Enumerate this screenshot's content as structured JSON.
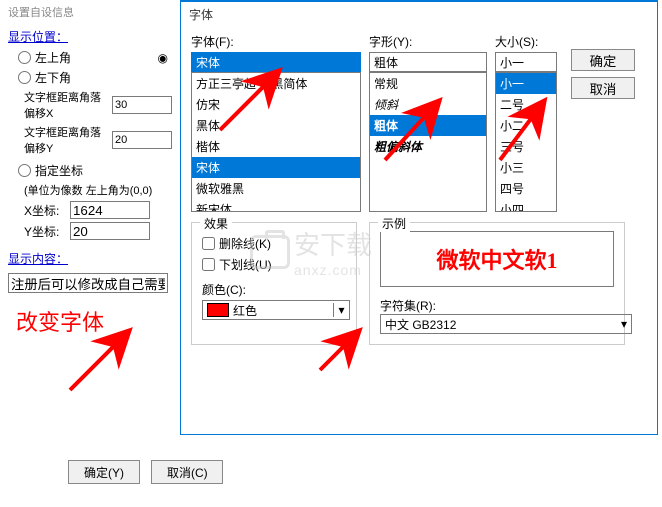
{
  "window_title": "设置自设信息",
  "left": {
    "pos_label": "显示位置：",
    "opt_topleft": "左上角",
    "opt_bottomleft": "左下角",
    "offset_x_label": "文字框距离角落偏移X",
    "offset_x": "30",
    "offset_y_label": "文字框距离角落偏移Y",
    "offset_y": "20",
    "opt_coord": "指定坐标",
    "coord_hint": "(单位为像数 左上角为(0,0)",
    "x_label": "X坐标:",
    "x_val": "1624",
    "y_label": "Y坐标:",
    "y_val": "20",
    "content_label": "显示内容：",
    "content_val": "注册后可以修改成自己需要的！",
    "big_red": "改变字体",
    "ok": "确定(Y)",
    "cancel": "取消(C)"
  },
  "dlg": {
    "title": "字体",
    "font_label": "字体(F):",
    "font_value": "宋体",
    "font_items": [
      "方正三亭超 田黑简体",
      "仿宋",
      "黑体",
      "楷体",
      "宋体",
      "微软雅黑",
      "新宋体"
    ],
    "font_sel_index": 4,
    "style_label": "字形(Y):",
    "style_value": "粗体",
    "style_items": [
      "常规",
      "倾斜",
      "粗体",
      "粗偏斜体"
    ],
    "style_sel_index": 2,
    "size_label": "大小(S):",
    "size_value": "小一",
    "size_items": [
      "小一",
      "二号",
      "小二",
      "三号",
      "小三",
      "四号",
      "小四"
    ],
    "size_sel_index": 0,
    "ok": "确定",
    "cancel": "取消",
    "effects": "效果",
    "strike": "删除线(K)",
    "underline": "下划线(U)",
    "color_label": "颜色(C):",
    "color_name": "红色",
    "color_hex": "#ff0000",
    "sample_label": "示例",
    "sample_text": "微软中文软1",
    "charset_label": "字符集(R):",
    "charset_value": "中文 GB2312"
  },
  "watermark": {
    "line1": "安下载",
    "line2": "anxz.com"
  }
}
